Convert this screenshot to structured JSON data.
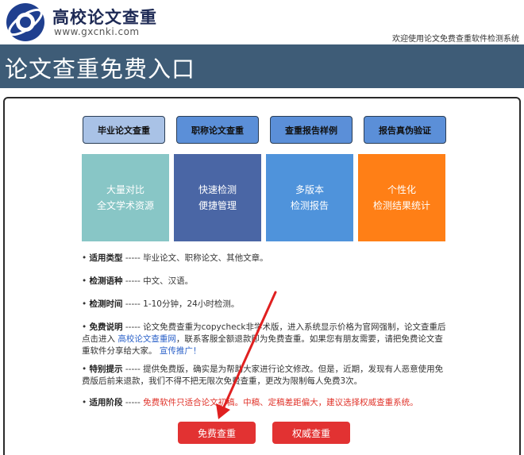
{
  "header": {
    "logo_title": "高校论文查重",
    "logo_url": "www.gxcnki.com",
    "welcome": "欢迎使用论文免费查重软件检测系统"
  },
  "banner": {
    "title": "论文查重免费入口"
  },
  "tabs": [
    {
      "label": "毕业论文查重",
      "active": true
    },
    {
      "label": "职称论文查重",
      "active": false
    },
    {
      "label": "查重报告样例",
      "active": false
    },
    {
      "label": "报告真伪验证",
      "active": false
    }
  ],
  "features": [
    {
      "line1": "大量对比",
      "line2": "全文学术资源",
      "color": "#88c6c6"
    },
    {
      "line1": "快速检测",
      "line2": "便捷管理",
      "color": "#4a66a5"
    },
    {
      "line1": "多版本",
      "line2": "检测报告",
      "color": "#4f93db"
    },
    {
      "line1": "个性化",
      "line2": "检测结果统计",
      "color": "#ff7f16"
    }
  ],
  "info": {
    "type": {
      "label": "适用类型",
      "sep": " ----- ",
      "text": "毕业论文、职称论文、其他文章。"
    },
    "lang": {
      "label": "检测语种",
      "sep": " ----- ",
      "text": "中文、汉语。"
    },
    "time": {
      "label": "检测时间",
      "sep": " ----- ",
      "text": "1-10分钟，24小时检测。"
    },
    "free": {
      "label": "免费说明",
      "sep": " ----- ",
      "text1": "论文免费查重为copycheck非学术版，进入系统显示价格为官网强制，论文查重后点击进入",
      "link": "高校论文查重网",
      "text2": "，联系客服全额退款即为免费查重。如果您有朋友需要，请把免费论文查重软件分享给大家。",
      "link2": "宣传推广！"
    },
    "notice": {
      "label": "特别提示",
      "sep": " ----- ",
      "text": "提供免费版，确实是为帮助大家进行论文修改。但是，近期，发现有人恶意使用免费版后前来退款，我们不得不把无限次免费查重，更改为限制每人免费3次。"
    },
    "stage": {
      "label": "适用阶段",
      "sep": " ----- ",
      "text": "免费软件只适合论文初稿。中稿、定稿差距偏大，建议选择权威查重系统。"
    }
  },
  "buttons": {
    "free_check": "免费查重",
    "auth_check": "权威查重"
  },
  "colors": {
    "banner": "#3e5c77",
    "tab": "#5b8fd8",
    "tab_active": "#a9c2e6",
    "button": "#e23232",
    "arrow": "#e02020",
    "link": "#2c62c9"
  }
}
